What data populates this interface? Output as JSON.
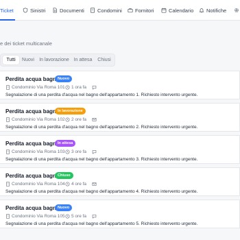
{
  "nav": {
    "items": [
      {
        "label": "Ticket",
        "icon": "ticket-icon",
        "active": true
      },
      {
        "label": "Sinistri",
        "icon": "shield-icon"
      },
      {
        "label": "Documenti",
        "icon": "document-icon"
      },
      {
        "label": "Condomini",
        "icon": "building-icon"
      },
      {
        "label": "Fornitori",
        "icon": "briefcase-icon"
      },
      {
        "label": "Calendario",
        "icon": "calendar-icon"
      },
      {
        "label": "Notifiche",
        "icon": "bell-icon"
      }
    ],
    "accent": "#2563eb"
  },
  "page": {
    "subtitle": "e dei ticket multicanale"
  },
  "tabs": [
    {
      "label": "Tutti",
      "active": true
    },
    {
      "label": "Nuovi"
    },
    {
      "label": "In lavorazione"
    },
    {
      "label": "In attesa"
    },
    {
      "label": "Chiusi"
    }
  ],
  "tickets": [
    {
      "title": "Perdita acqua bagno",
      "status": "Nuovo",
      "status_color": "#3b82f6",
      "building": "Condominio Via Roma 101",
      "time": "1 ora fa",
      "channel_icon": "chat-icon",
      "description": "Segnalazione di una perdita d'acqua nel bagno dell'appartamento 1. Richiesto intervento urgente."
    },
    {
      "title": "Perdita acqua bagno",
      "status": "In lavorazione",
      "status_color": "#f59e0b",
      "building": "Condominio Via Roma 102",
      "time": "2 ore fa",
      "channel_icon": "mail-icon",
      "description": "Segnalazione di una perdita d'acqua nel bagno dell'appartamento 2. Richiesto intervento urgente."
    },
    {
      "title": "Perdita acqua bagno",
      "status": "In attesa",
      "status_color": "#a855f7",
      "building": "Condominio Via Roma 103",
      "time": "3 ore fa",
      "channel_icon": "chat-icon",
      "description": "Segnalazione di una perdita d'acqua nel bagno dell'appartamento 3. Richiesto intervento urgente."
    },
    {
      "title": "Perdita acqua bagno",
      "status": "Chiuso",
      "status_color": "#22c55e",
      "building": "Condominio Via Roma 104",
      "time": "4 ore fa",
      "channel_icon": "mail-icon",
      "description": "Segnalazione di una perdita d'acqua nel bagno dell'appartamento 4. Richiesto intervento urgente."
    },
    {
      "title": "Perdita acqua bagno",
      "status": "Nuovo",
      "status_color": "#3b82f6",
      "building": "Condominio Via Roma 105",
      "time": "5 ore fa",
      "channel_icon": "chat-icon",
      "description": "Segnalazione di una perdita d'acqua nel bagno dell'appartamento 5. Richiesto intervento urgente."
    }
  ]
}
